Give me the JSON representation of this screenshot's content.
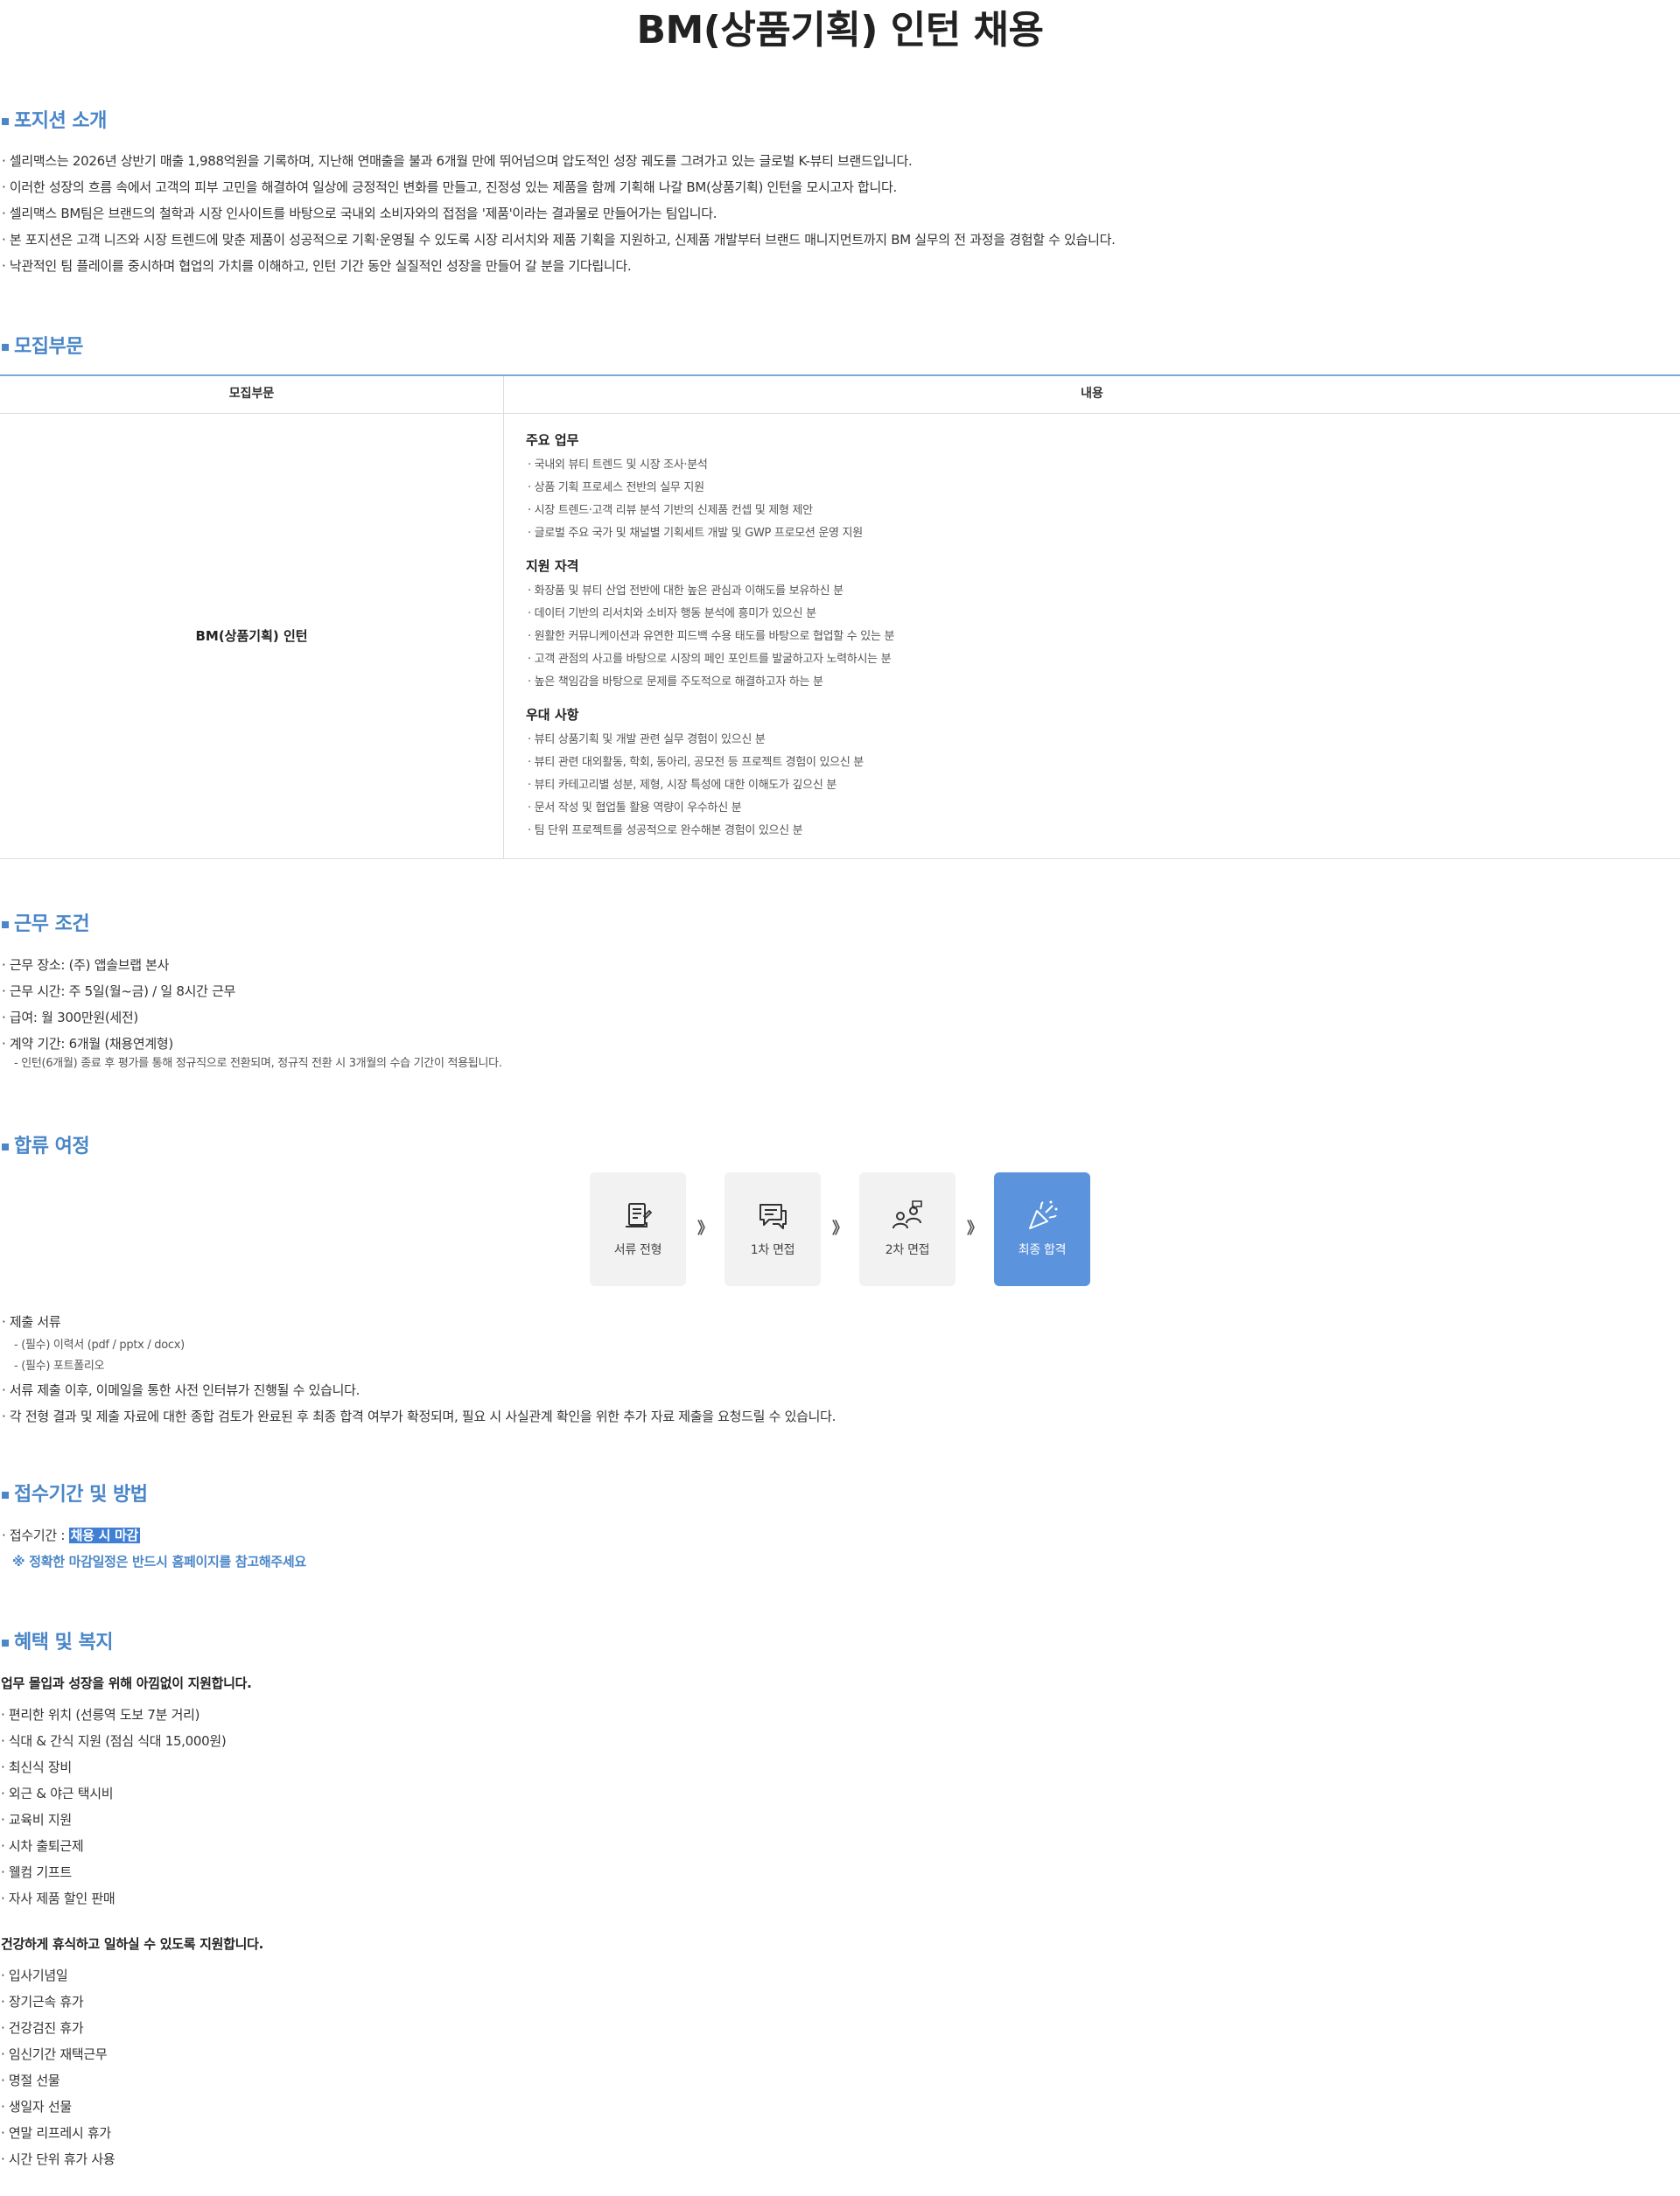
{
  "title": "BM(상품기획) 인턴 채용",
  "position_intro": {
    "heading": "포지션 소개",
    "items": [
      "· 셀리맥스는 2026년 상반기 매출 1,988억원을 기록하며, 지난해 연매출을 불과 6개월 만에 뛰어넘으며 압도적인 성장 궤도를 그려가고 있는 글로벌 K-뷰티 브랜드입니다.",
      "· 이러한 성장의 흐름 속에서 고객의 피부 고민을 해결하여 일상에 긍정적인 변화를 만들고, 진정성 있는 제품을 함께 기획해 나갈 BM(상품기획) 인턴을 모시고자 합니다.",
      "· 셀리맥스 BM팀은 브랜드의 철학과 시장 인사이트를 바탕으로 국내외 소비자와의 접점을 '제품'이라는 결과물로 만들어가는 팀입니다.",
      "· 본 포지션은 고객 니즈와 시장 트렌드에 맞춘 제품이 성공적으로 기획·운영될 수 있도록 시장 리서치와 제품 기획을 지원하고, 신제품 개발부터 브랜드 매니지먼트까지 BM 실무의 전 과정을 경험할 수 있습니다.",
      "· 낙관적인 팀 플레이를 중시하며 협업의 가치를 이해하고, 인턴 기간 동안 실질적인 성장을 만들어 갈 분을 기다립니다."
    ]
  },
  "recruit": {
    "heading": "모집부문",
    "col_left": "모집부문",
    "col_right": "내용",
    "role": "BM(상품기획) 인턴",
    "groups": [
      {
        "title": "주요 업무",
        "items": [
          "· 국내외 뷰티 트렌드 및 시장 조사·분석",
          "· 상품 기획 프로세스 전반의 실무 지원",
          "· 시장 트렌드·고객 리뷰 분석 기반의 신제품 컨셉 및 제형 제안",
          "· 글로벌 주요 국가 및 채널별 기획세트 개발 및 GWP 프로모션 운영 지원"
        ]
      },
      {
        "title": "지원 자격",
        "items": [
          "· 화장품 및 뷰티 산업 전반에 대한 높은 관심과 이해도를 보유하신 분",
          "· 데이터 기반의 리서치와 소비자 행동 분석에 흥미가 있으신 분",
          "· 원활한 커뮤니케이션과 유연한 피드백 수용 태도를 바탕으로 협업할 수 있는 분",
          "· 고객 관점의 사고를 바탕으로 시장의 페인 포인트를 발굴하고자 노력하시는 분",
          "· 높은 책임감을 바탕으로 문제를 주도적으로 해결하고자 하는 분"
        ]
      },
      {
        "title": "우대 사항",
        "items": [
          "· 뷰티 상품기획 및 개발 관련 실무 경험이 있으신 분",
          "· 뷰티 관련 대외활동, 학회, 동아리, 공모전 등 프로젝트 경험이 있으신 분",
          "· 뷰티 카테고리별 성분, 제형, 시장 특성에 대한 이해도가 깊으신 분",
          "· 문서 작성 및 협업툴 활용 역량이 우수하신 분",
          "· 팀 단위 프로젝트를 성공적으로 완수해본 경험이 있으신 분"
        ]
      }
    ]
  },
  "conditions": {
    "heading": "근무 조건",
    "items": [
      "· 근무 장소: (주) 앱솔브랩 본사",
      "· 근무 시간: 주 5일(월~금) / 일 8시간 근무",
      "· 급여: 월 300만원(세전)",
      "· 계약 기간: 6개월 (채용연계형)"
    ],
    "note": "- 인턴(6개월) 종료 후 평가를 통해 정규직으로 전환되며, 정규직 전환 시 3개월의 수습 기간이 적용됩니다."
  },
  "process": {
    "heading": "합류 여정",
    "arrow": "》",
    "steps": [
      {
        "label": "서류 전형",
        "icon": "document-icon"
      },
      {
        "label": "1차 면접",
        "icon": "chat-icon"
      },
      {
        "label": "2차 면접",
        "icon": "interview-icon"
      },
      {
        "label": "최종 합격",
        "icon": "celebration-icon"
      }
    ],
    "docs_title": "· 제출 서류",
    "docs": [
      "- (필수) 이력서 (pdf / pptx / docx)",
      "- (필수) 포트폴리오"
    ],
    "notes": [
      "· 서류 제출 이후, 이메일을 통한 사전 인터뷰가 진행될 수 있습니다.",
      "· 각 전형 결과 및 제출 자료에 대한 종합 검토가 완료된 후 최종 합격 여부가 확정되며, 필요 시 사실관계 확인을 위한 추가 자료 제출을 요청드릴 수 있습니다."
    ]
  },
  "application": {
    "heading": "접수기간 및 방법",
    "period_label": "· 접수기간 : ",
    "period_value": "채용 시 마감",
    "notice": "※ 정확한 마감일정은 반드시 홈페이지를 참고해주세요"
  },
  "benefits": {
    "heading": "혜택 및 복지",
    "group1_lead": "업무 몰입과 성장을 위해 아낌없이 지원합니다.",
    "group1": [
      "· 편리한 위치 (선릉역 도보 7분 거리)",
      "· 식대 & 간식 지원 (점심 식대 15,000원)",
      "· 최신식 장비",
      "· 외근 & 야근 택시비",
      "· 교육비 지원",
      "· 시차 출퇴근제",
      "· 웰컴 기프트",
      "· 자사 제품 할인 판매"
    ],
    "group2_lead": "건강하게 휴식하고 일하실 수 있도록 지원합니다.",
    "group2": [
      "· 입사기념일",
      "· 장기근속 휴가",
      "· 건강검진 휴가",
      "· 임신기간 재택근무",
      "· 명절 선물",
      "· 생일자 선물",
      "· 연말 리프레시 휴가",
      "· 시간 단위 휴가 사용"
    ]
  },
  "colors": {
    "accent": "#4a86c8",
    "final_step": "#5b93dc",
    "table_rule": "#7fa7d6"
  }
}
